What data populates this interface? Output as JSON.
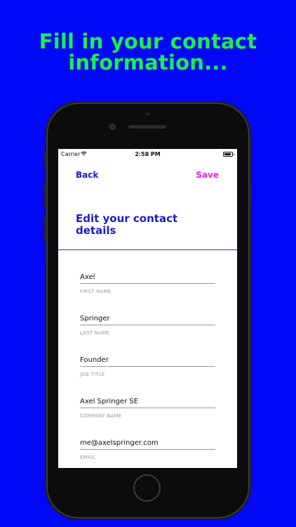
{
  "marketing": {
    "headline_line1": "Fill in your contact",
    "headline_line2": "information..."
  },
  "statusbar": {
    "carrier": "Carrier",
    "time": "2:58 PM"
  },
  "nav": {
    "back_label": "Back",
    "save_label": "Save"
  },
  "page": {
    "title": "Edit your contact details"
  },
  "fields": [
    {
      "value": "Axel",
      "label": "FIRST NAME"
    },
    {
      "value": "Springer",
      "label": "LAST NAME"
    },
    {
      "value": "Founder",
      "label": "JOB TITLE"
    },
    {
      "value": "Axel Springer SE",
      "label": "COMPANY NAME"
    },
    {
      "value": "me@axelspringer.com",
      "label": "EMAIL"
    }
  ],
  "colors": {
    "background": "#0008f5",
    "headline": "#19f04a",
    "accent_blue": "#1a1fc8",
    "save_pink": "#ee1ce0"
  }
}
